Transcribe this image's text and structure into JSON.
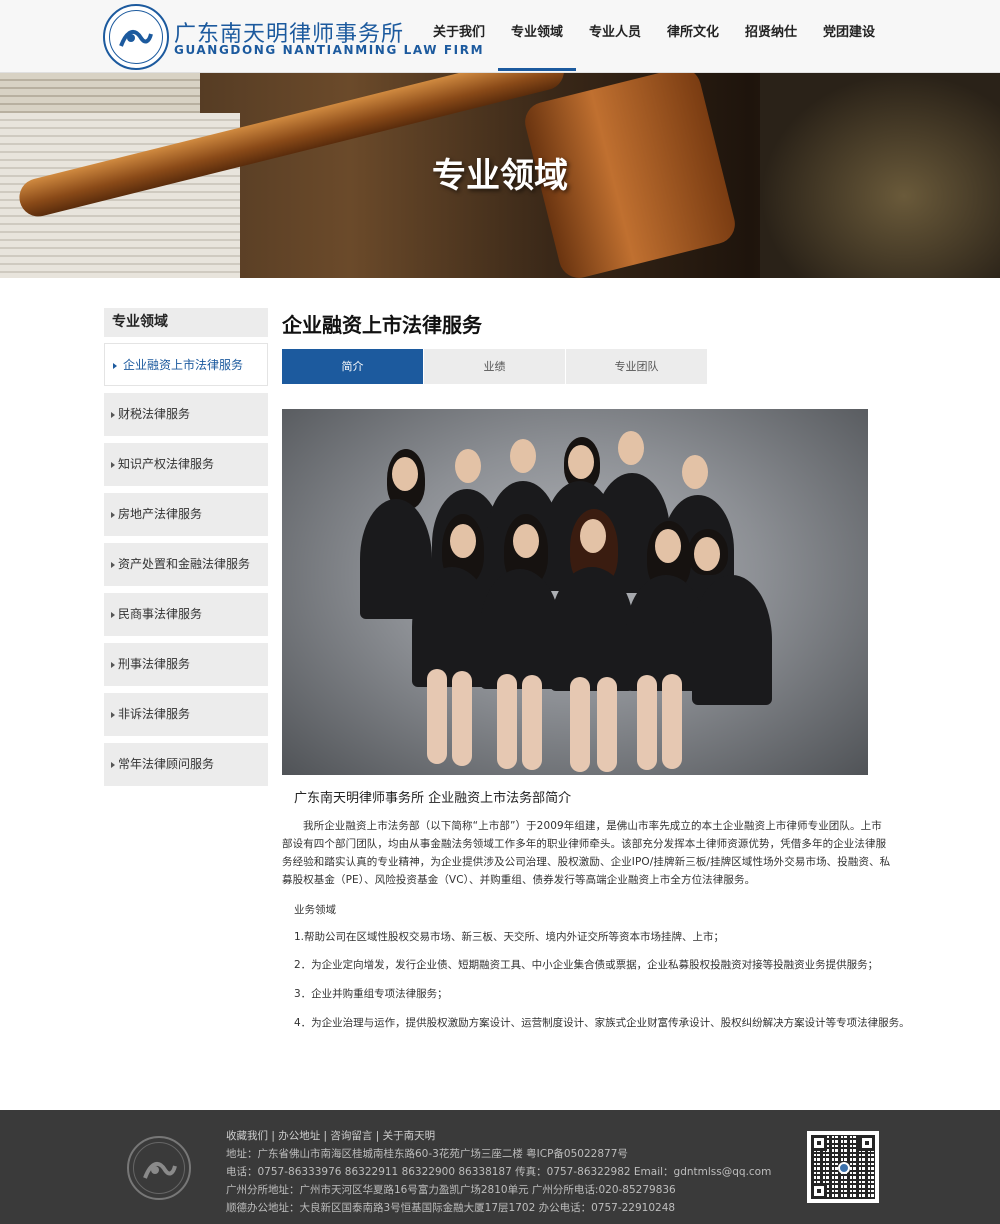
{
  "header": {
    "brand_cn": "广东南天明律师事务所",
    "brand_en": "GUANGDONG NANTIANMING LAW FIRM",
    "nav": [
      "关于我们",
      "专业领域",
      "专业人员",
      "律所文化",
      "招贤纳仕",
      "党团建设"
    ],
    "active_nav": "专业领域"
  },
  "banner": {
    "title": "专业领域"
  },
  "sidebar": {
    "title": "专业领域",
    "items": [
      "企业融资上市法律服务",
      "财税法律服务",
      "知识产权法律服务",
      "房地产法律服务",
      "资产处置和金融法律服务",
      "民商事法律服务",
      "刑事法律服务",
      "非诉法律服务",
      "常年法律顾问服务"
    ],
    "active": "企业融资上市法律服务"
  },
  "main": {
    "title": "企业融资上市法律服务",
    "tabs": [
      "简介",
      "业绩",
      "专业团队"
    ],
    "active_tab": "简介",
    "subtitle": "广东南天明律师事务所 企业融资上市法务部简介",
    "intro": "我所企业融资上市法务部（以下简称“上市部”）于2009年组建，是佛山市率先成立的本土企业融资上市律师专业团队。上市部设有四个部门团队，均由从事金融法务领域工作多年的职业律师牵头。该部充分发挥本土律师资源优势，凭借多年的企业法律服务经验和踏实认真的专业精神，为企业提供涉及公司治理、股权激励、企业IPO/挂牌新三板/挂牌区域性场外交易市场、投融资、私募股权基金（PE）、风险投资基金（VC）、并购重组、债券发行等高端企业融资上市全方位法律服务。",
    "biz_heading": "业务领域",
    "biz_items": [
      "1.帮助公司在区域性股权交易市场、新三板、天交所、境内外证交所等资本市场挂牌、上市；",
      "2．为企业定向增发，发行企业债、短期融资工具、中小企业集合债或票据，企业私募股权投融资对接等投融资业务提供服务；",
      "3．企业并购重组专项法律服务；",
      "4．为企业治理与运作，提供股权激励方案设计、运营制度设计、家族式企业财富传承设计、股权纠纷解决方案设计等专项法律服务。"
    ]
  },
  "footer": {
    "links": "收藏我们 | 办公地址 | 咨询留言 | 关于南天明",
    "lines": [
      "地址：广东省佛山市南海区桂城南桂东路60-3花苑广场三座二楼 粤ICP备05022877号",
      "电话：0757-86333976 86322911 86322900 86338187   传真：0757-86322982 Email：gdntmlss@qq.com",
      "广州分所地址：广州市天河区华夏路16号富力盈凯广场2810单元 广州分所电话:020-85279836",
      "顺德办公地址：大良新区国泰南路3号恒基国际金融大厦17层1702 办公电话：0757-22910248"
    ]
  },
  "colors": {
    "accent": "#1c5a9e",
    "footer_bg": "#3a3a3a",
    "sidebar_bg": "#ececec"
  }
}
